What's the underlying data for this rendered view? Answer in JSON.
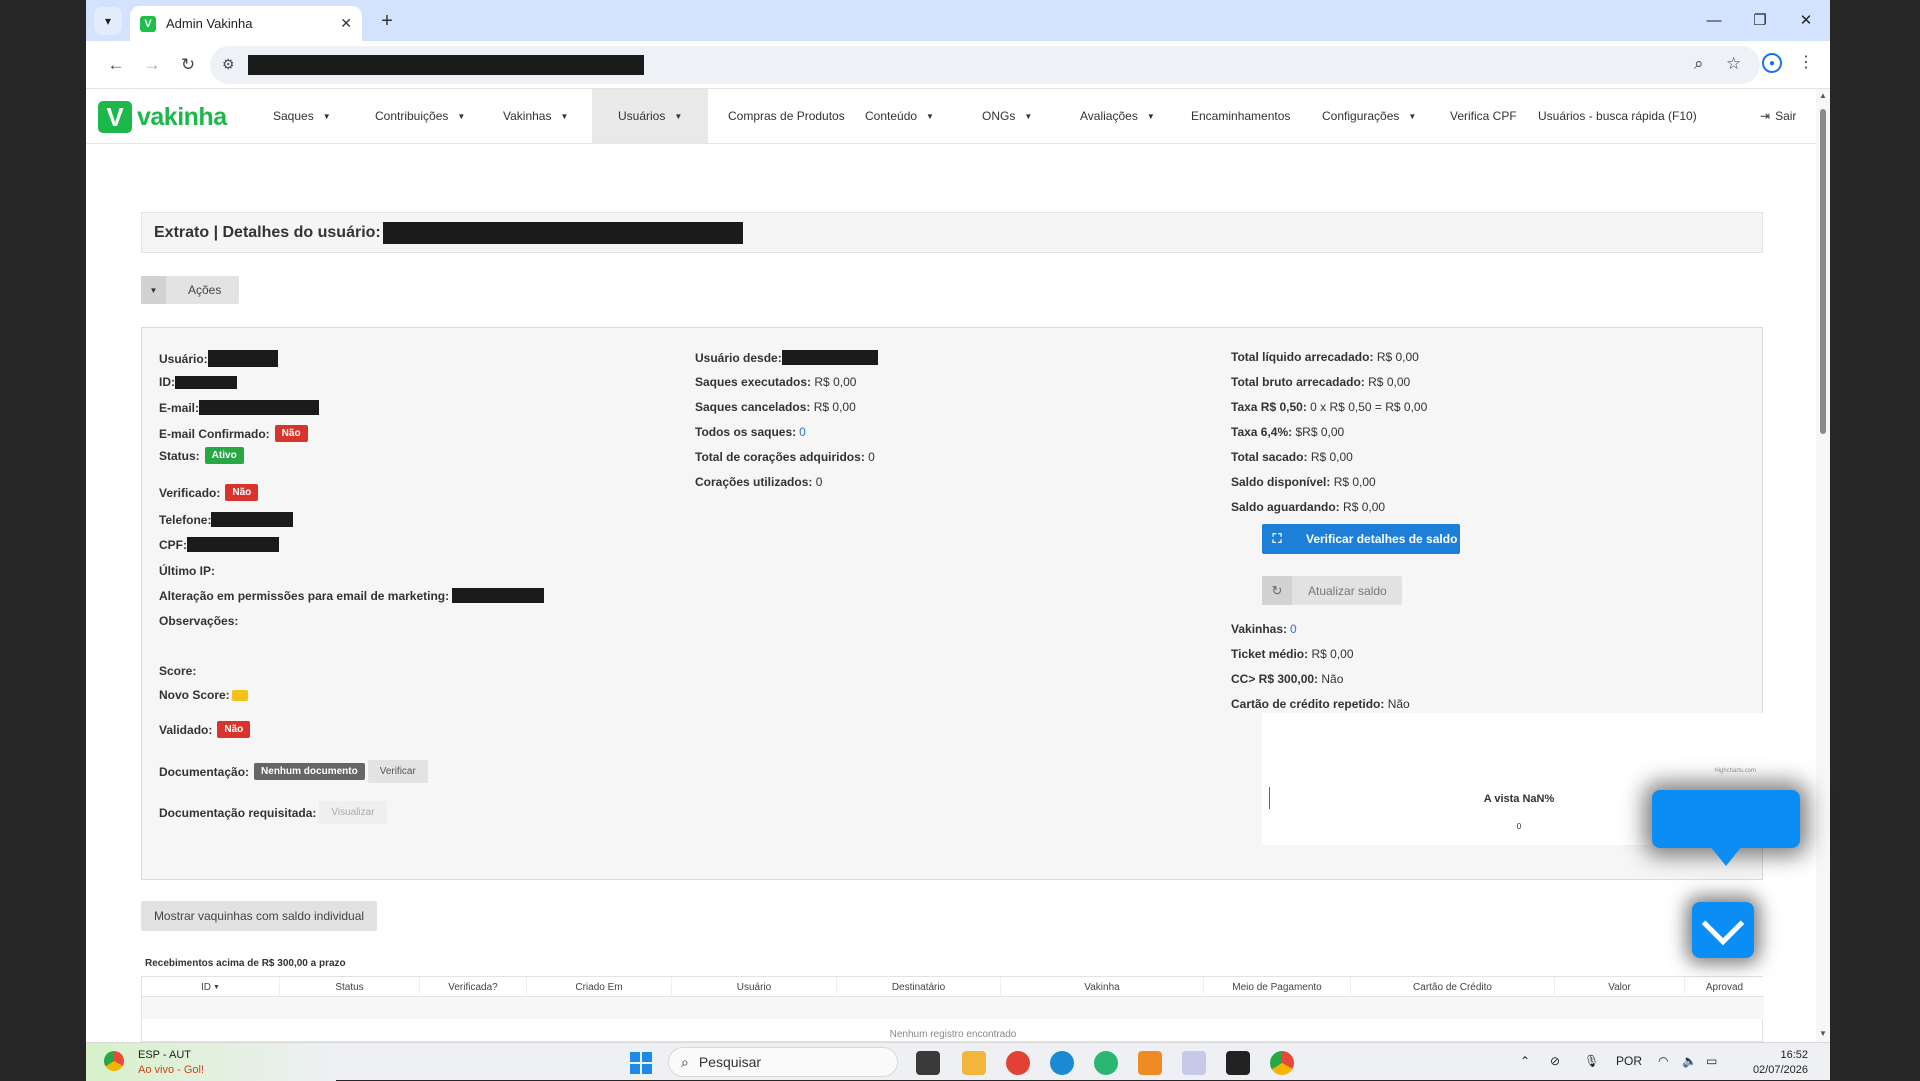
{
  "browser": {
    "tab_title": "Admin Vakinha",
    "tab_favicon": "V",
    "tab_list_icon": "chevron-down-icon",
    "window_controls": {
      "minimize": "—",
      "maximize": "❐",
      "close": "✕"
    }
  },
  "nav": {
    "logo_text": "vakinha",
    "logo_mark": "V",
    "items": [
      {
        "label": "Saques",
        "dropdown": true
      },
      {
        "label": "Contribuições",
        "dropdown": true
      },
      {
        "label": "Vakinhas",
        "dropdown": true
      },
      {
        "label": "Usuários",
        "dropdown": true,
        "active": true
      },
      {
        "label": "Compras de Produtos",
        "dropdown": false
      },
      {
        "label": "Conteúdo",
        "dropdown": true
      },
      {
        "label": "ONGs",
        "dropdown": true
      },
      {
        "label": "Avaliações",
        "dropdown": true
      },
      {
        "label": "Encaminhamentos",
        "dropdown": false
      },
      {
        "label": "Configurações",
        "dropdown": true
      },
      {
        "label": "Verifica CPF",
        "dropdown": false
      },
      {
        "label": "Usuários - busca rápida (F10)",
        "dropdown": false
      }
    ],
    "logout_label": "Sair"
  },
  "page": {
    "title": "Extrato | Detalhes do usuário:",
    "actions_label": "Ações"
  },
  "user": {
    "usuario_label": "Usuário:",
    "id_label": "ID:",
    "email_label": "E-mail:",
    "email_confirmado_label": "E-mail Confirmado:",
    "email_confirmado_value": "Não",
    "status_label": "Status:",
    "status_value": "Ativo",
    "verificado_label": "Verificado:",
    "verificado_value": "Não",
    "telefone_label": "Telefone:",
    "cpf_label": "CPF:",
    "ultimo_ip_label": "Último IP:",
    "marketing_label": "Alteração em permissões para email de marketing:",
    "observacoes_label": "Observações:",
    "score_label": "Score:",
    "novo_score_label": "Novo Score:",
    "validado_label": "Validado:",
    "validado_value": "Não",
    "documentacao_label": "Documentação:",
    "documentacao_value": "Nenhum documento",
    "verificar_label": "Verificar",
    "doc_requisitada_label": "Documentação requisitada:",
    "visualizar_label": "Visualizar"
  },
  "middle": {
    "usuario_desde_label": "Usuário desde:",
    "saques_executados_label": "Saques executados:",
    "saques_executados_value": "R$ 0,00",
    "saques_cancelados_label": "Saques cancelados:",
    "saques_cancelados_value": "R$ 0,00",
    "todos_saques_label": "Todos os saques:",
    "todos_saques_value": "0",
    "coracoes_adquiridos_label": "Total de corações adquiridos:",
    "coracoes_adquiridos_value": "0",
    "coracoes_utilizados_label": "Corações utilizados:",
    "coracoes_utilizados_value": "0"
  },
  "totals": {
    "liquido_label": "Total líquido arrecadado:",
    "liquido_value": "R$ 0,00",
    "bruto_label": "Total bruto arrecadado:",
    "bruto_value": "R$ 0,00",
    "taxa050_label": "Taxa R$ 0,50:",
    "taxa050_value": "0 x R$ 0,50 = R$ 0,00",
    "taxa64_label": "Taxa 6,4%:",
    "taxa64_value": "$R$ 0,00",
    "sacado_label": "Total sacado:",
    "sacado_value": "R$ 0,00",
    "disponivel_label": "Saldo disponível:",
    "disponivel_value": "R$ 0,00",
    "aguardando_label": "Saldo aguardando:",
    "aguardando_value": "R$ 0,00",
    "verificar_saldo_btn": "Verificar detalhes de saldo",
    "atualizar_saldo_btn": "Atualizar saldo",
    "vakinhas_label": "Vakinhas:",
    "vakinhas_value": "0",
    "ticket_label": "Ticket médio:",
    "ticket_value": "R$ 0,00",
    "cc_label": "CC> R$ 300,00:",
    "cc_value": "Não",
    "cartao_label": "Cartão de crédito repetido:",
    "cartao_value": "Não"
  },
  "chart": {
    "credit": "Highcharts.com",
    "title": "A vista NaN%",
    "zero_label": "0"
  },
  "table": {
    "show_btn": "Mostrar vaquinhas com saldo individual",
    "caption": "Recebimentos acima de R$ 300,00 a prazo",
    "headers": [
      "ID",
      "Status",
      "Verificada?",
      "Criado Em",
      "Usuário",
      "Destinatário",
      "Vakinha",
      "Meio de Pagamento",
      "Cartão de Crédito",
      "Valor",
      "Aprovad"
    ],
    "empty_message": "Nenhum registro encontrado"
  },
  "taskbar": {
    "weather_line1": "ESP - AUT",
    "weather_line2": "Ao vivo - Gol!",
    "search_placeholder": "Pesquisar",
    "language": "POR",
    "time": "16:52",
    "date": "02/07/2026"
  }
}
